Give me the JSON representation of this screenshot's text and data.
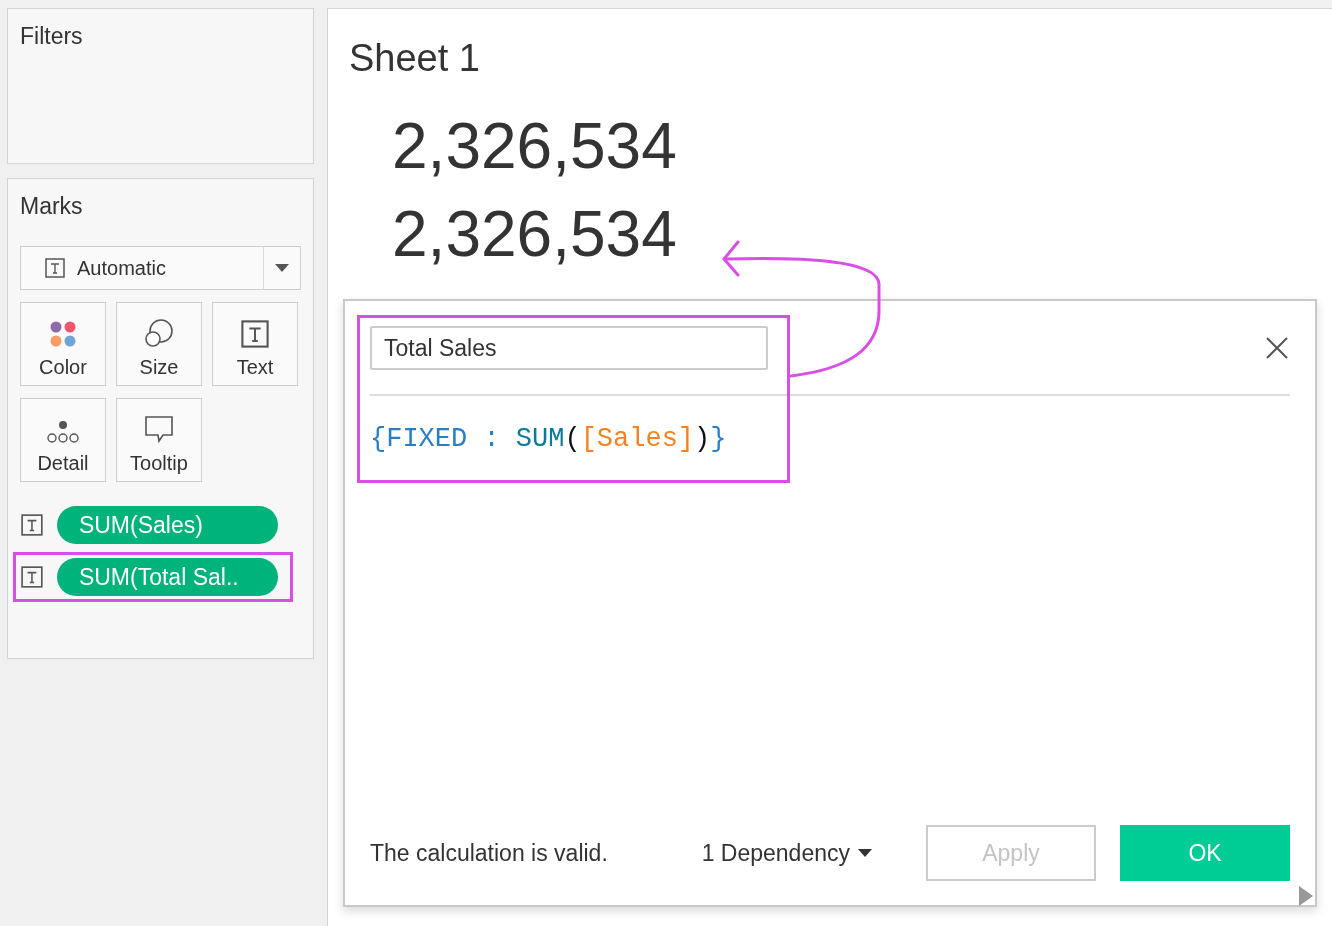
{
  "filters": {
    "title": "Filters"
  },
  "marks": {
    "title": "Marks",
    "mark_type": "Automatic",
    "cards": [
      {
        "kind": "color",
        "label": "Color"
      },
      {
        "kind": "size",
        "label": "Size"
      },
      {
        "kind": "text",
        "label": "Text"
      },
      {
        "kind": "detail",
        "label": "Detail"
      },
      {
        "kind": "tooltip",
        "label": "Tooltip"
      }
    ],
    "pills": [
      {
        "label": "SUM(Sales)",
        "highlighted": false
      },
      {
        "label": "SUM(Total Sal..",
        "highlighted": true
      }
    ]
  },
  "sheet": {
    "title": "Sheet 1",
    "values": [
      "2,326,534",
      "2,326,534"
    ]
  },
  "dialog": {
    "name": "Total Sales",
    "highlighted": true,
    "formula": [
      {
        "text": "{FIXED",
        "kind": "keyword"
      },
      {
        "text": " : ",
        "kind": "keyword"
      },
      {
        "text": "SUM",
        "kind": "function"
      },
      {
        "text": "(",
        "kind": "paren"
      },
      {
        "text": "[Sales]",
        "kind": "field"
      },
      {
        "text": ")",
        "kind": "paren"
      },
      {
        "text": "}",
        "kind": "keyword"
      }
    ],
    "status": "The calculation is valid.",
    "dependency": "1 Dependency",
    "buttons": [
      {
        "label": "Apply",
        "kind": "secondary",
        "disabled": true
      },
      {
        "label": "OK",
        "kind": "primary",
        "disabled": false
      }
    ]
  }
}
